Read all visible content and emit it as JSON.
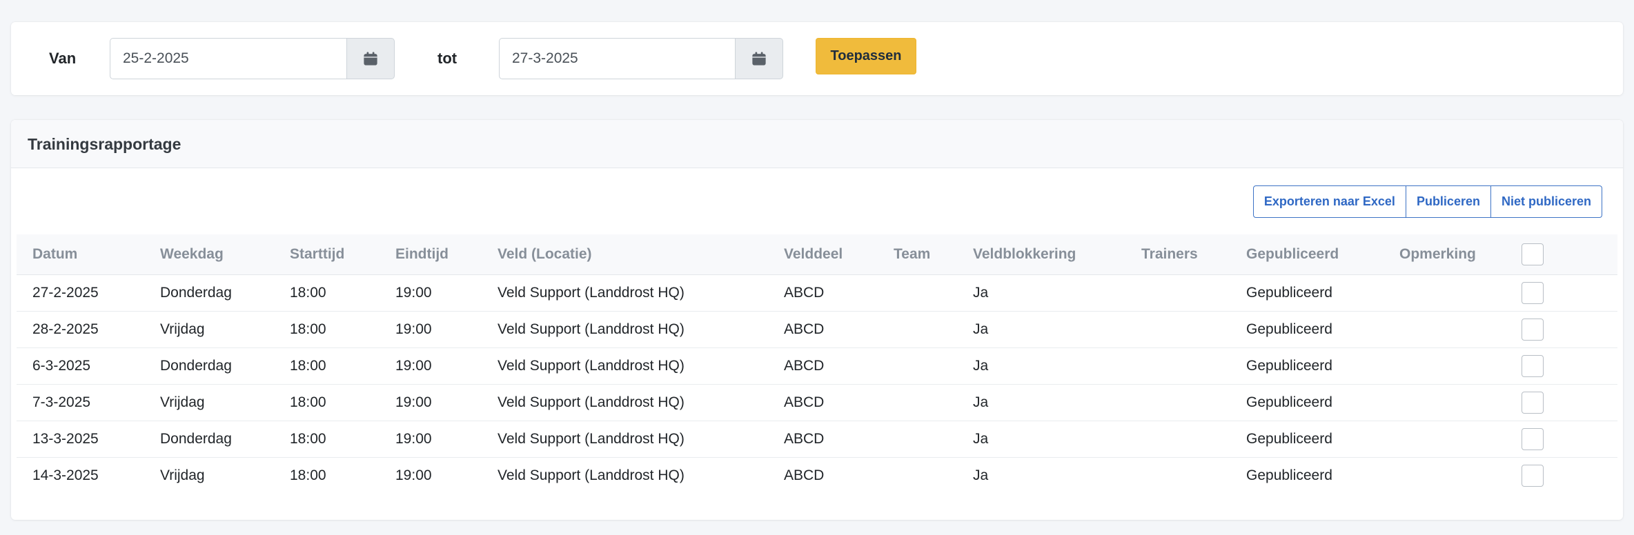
{
  "filter": {
    "from_label": "Van",
    "from_value": "25-2-2025",
    "to_label": "tot",
    "to_value": "27-3-2025",
    "apply_label": "Toepassen",
    "calendar_icon": "calendar-icon"
  },
  "report": {
    "title": "Trainingsrapportage",
    "actions": {
      "export_label": "Exporteren naar Excel",
      "publish_label": "Publiceren",
      "unpublish_label": "Niet publiceren"
    },
    "columns": [
      "Datum",
      "Weekdag",
      "Starttijd",
      "Eindtijd",
      "Veld (Locatie)",
      "Velddeel",
      "Team",
      "Veldblokkering",
      "Trainers",
      "Gepubliceerd",
      "Opmerking"
    ],
    "rows": [
      [
        "27-2-2025",
        "Donderdag",
        "18:00",
        "19:00",
        "Veld Support (Landdrost HQ)",
        "ABCD",
        "",
        "Ja",
        "",
        "Gepubliceerd",
        ""
      ],
      [
        "28-2-2025",
        "Vrijdag",
        "18:00",
        "19:00",
        "Veld Support (Landdrost HQ)",
        "ABCD",
        "",
        "Ja",
        "",
        "Gepubliceerd",
        ""
      ],
      [
        "6-3-2025",
        "Donderdag",
        "18:00",
        "19:00",
        "Veld Support (Landdrost HQ)",
        "ABCD",
        "",
        "Ja",
        "",
        "Gepubliceerd",
        ""
      ],
      [
        "7-3-2025",
        "Vrijdag",
        "18:00",
        "19:00",
        "Veld Support (Landdrost HQ)",
        "ABCD",
        "",
        "Ja",
        "",
        "Gepubliceerd",
        ""
      ],
      [
        "13-3-2025",
        "Donderdag",
        "18:00",
        "19:00",
        "Veld Support (Landdrost HQ)",
        "ABCD",
        "",
        "Ja",
        "",
        "Gepubliceerd",
        ""
      ],
      [
        "14-3-2025",
        "Vrijdag",
        "18:00",
        "19:00",
        "Veld Support (Landdrost HQ)",
        "ABCD",
        "",
        "Ja",
        "",
        "Gepubliceerd",
        ""
      ]
    ]
  },
  "colors": {
    "accent_button": "#f0bb3c",
    "link_blue": "#2f68c4",
    "page_bg": "#f4f6f9"
  }
}
